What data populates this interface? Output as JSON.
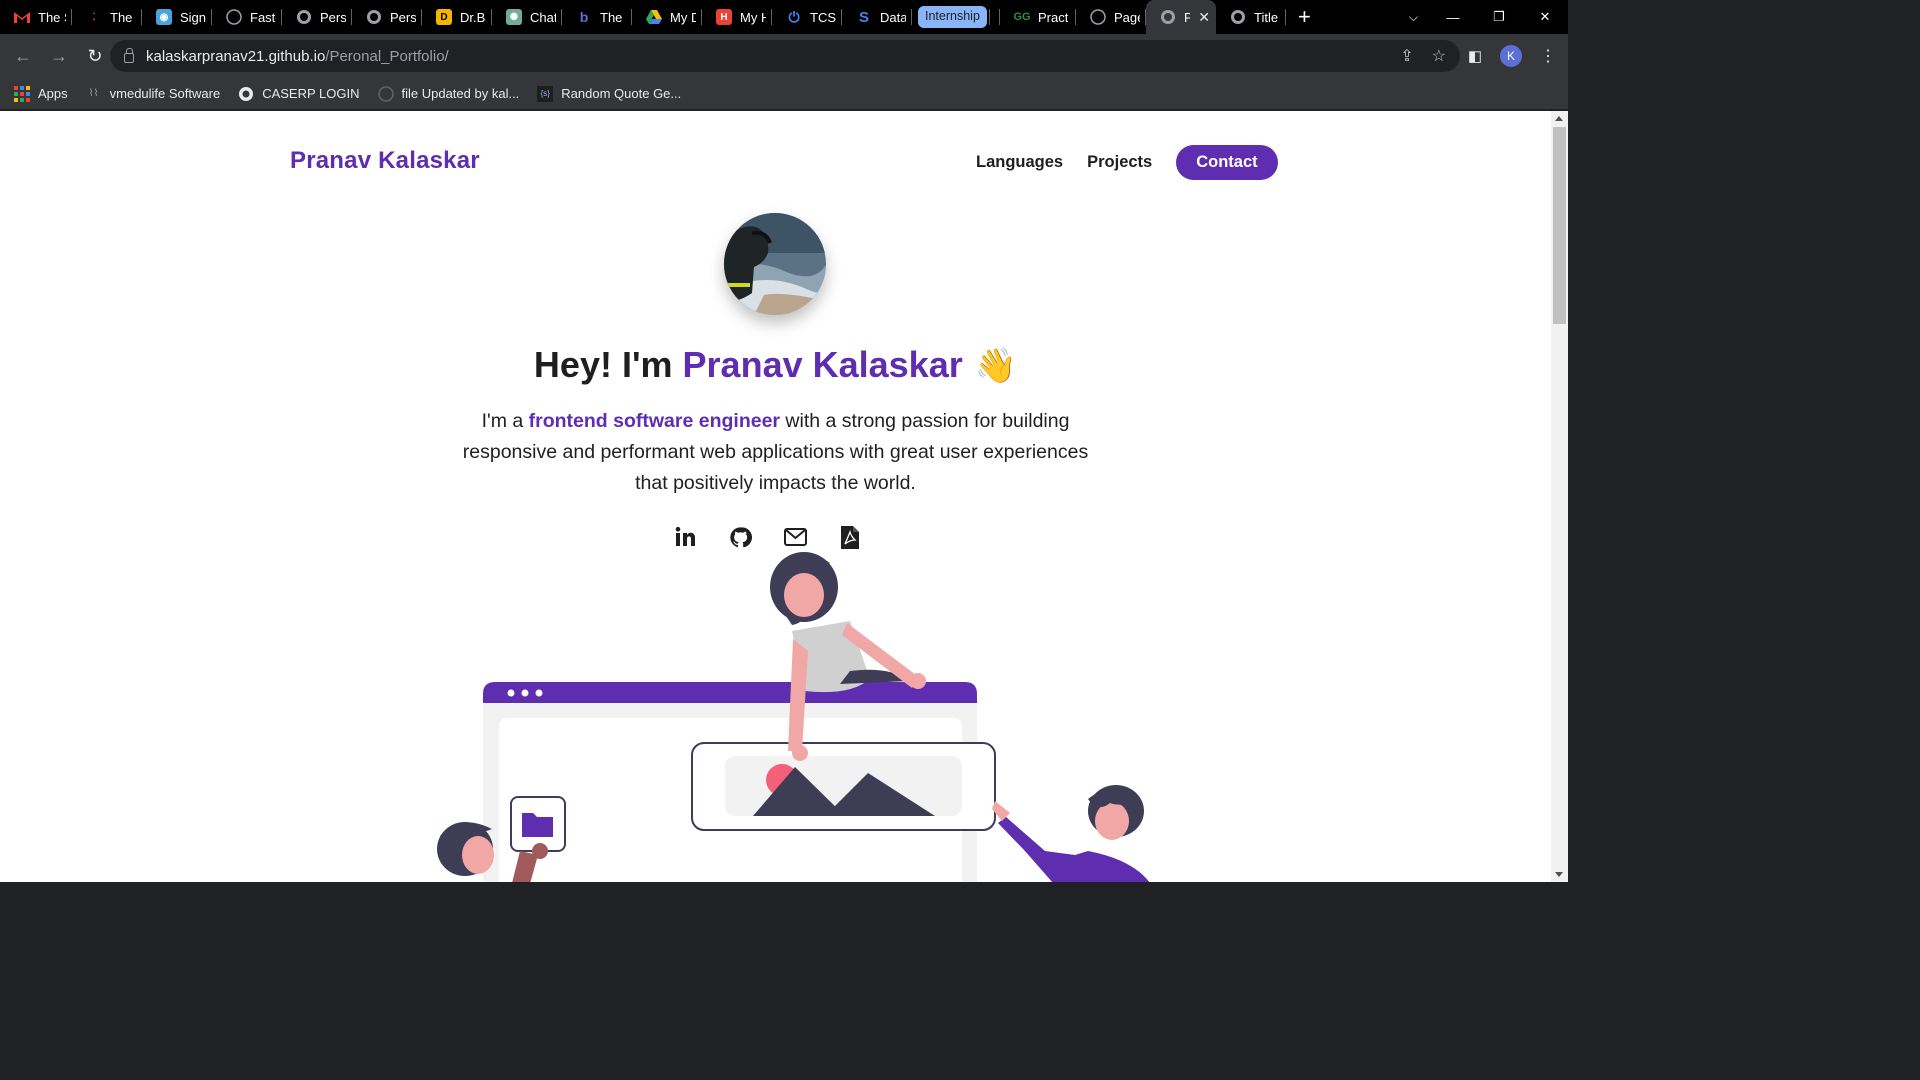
{
  "browser": {
    "tabs": [
      {
        "label": "The S",
        "icon": "gmail-icon",
        "color": "#ea4335"
      },
      {
        "label": "The S",
        "icon": "app-icon",
        "color": "#e8eaed"
      },
      {
        "label": "Sign i",
        "icon": "sign-icon",
        "color": "#4aa3df"
      },
      {
        "label": "Faste",
        "icon": "github-icon",
        "color": "#9aa0a6"
      },
      {
        "label": "Perso",
        "icon": "globe-icon",
        "color": "#9aa0a6"
      },
      {
        "label": "Perso",
        "icon": "globe-icon",
        "color": "#9aa0a6"
      },
      {
        "label": "Dr.Ba",
        "icon": "app-icon",
        "color": "#f4b400"
      },
      {
        "label": "ChatC",
        "icon": "chatgpt-icon",
        "color": "#74aa9c"
      },
      {
        "label": "The b",
        "icon": "b-icon",
        "color": "#5b6fd6"
      },
      {
        "label": "My D",
        "icon": "drive-icon",
        "color": "#fbbc04"
      },
      {
        "label": "My H",
        "icon": "app-icon",
        "color": "#ea4335"
      },
      {
        "label": "TCS iC",
        "icon": "power-icon",
        "color": "#4285f4"
      },
      {
        "label": "Data",
        "icon": "s-icon",
        "color": "#4285f4"
      }
    ],
    "group_label": "Internship",
    "tabs_after_group": [
      {
        "label": "Pract",
        "icon": "gfg-icon",
        "color": "#2f8d46"
      },
      {
        "label": "Page",
        "icon": "github-icon",
        "color": "#9aa0a6"
      }
    ],
    "active_tab": {
      "label": "Pr",
      "icon": "globe-icon"
    },
    "last_tab": {
      "label": "Title",
      "icon": "globe-icon"
    },
    "url_host": "kalaskarpranav21.github.io",
    "url_path": "/Peronal_Portfolio/",
    "profile_initial": "K",
    "bookmarks": [
      {
        "label": "Apps",
        "icon": "apps-grid-icon"
      },
      {
        "label": "vmedulife Software",
        "icon": "vmedulife-icon"
      },
      {
        "label": "CASERP LOGIN",
        "icon": "globe-icon"
      },
      {
        "label": "file Updated by kal...",
        "icon": "github-icon"
      },
      {
        "label": "Random Quote Ge...",
        "icon": "code-icon"
      }
    ]
  },
  "page": {
    "brand": "Pranav Kalaskar",
    "nav": {
      "languages": "Languages",
      "projects": "Projects",
      "contact": "Contact"
    },
    "hero": {
      "greeting": "Hey! I'm ",
      "name": "Pranav Kalaskar",
      "wave": "👋",
      "sub_prefix": "I'm a ",
      "sub_accent": "frontend software engineer",
      "sub_rest": " with a strong passion for building responsive and performant web applications with great user experiences that positively impacts the world."
    },
    "socials": [
      "linkedin-icon",
      "github-icon",
      "mail-icon",
      "pdf-resume-icon"
    ],
    "colors": {
      "accent": "#5f2eb0",
      "text": "#1f1f1f",
      "illustration_dark": "#3f3d56",
      "illustration_pink": "#f2a7a7"
    }
  }
}
